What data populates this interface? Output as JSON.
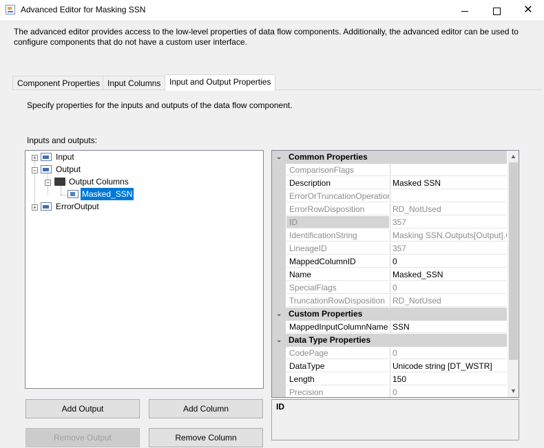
{
  "window": {
    "title": "Advanced Editor for Masking SSN",
    "minimize_label": "",
    "close_label": "✕"
  },
  "description": "The advanced editor provides access to the low-level properties of data flow components. Additionally, the advanced editor can be used to configure components that do not have a custom user interface.",
  "tabs": [
    {
      "label": "Component Properties"
    },
    {
      "label": "Input Columns"
    },
    {
      "label": "Input and Output Properties"
    }
  ],
  "panel": {
    "intro": "Specify properties for the inputs and outputs of the data flow component.",
    "io_label": "Inputs and outputs:"
  },
  "tree": {
    "input": "Input",
    "output": "Output",
    "output_columns": "Output Columns",
    "masked_ssn": "Masked_SSN",
    "error_output": "ErrorOutput",
    "expand_plus": "+",
    "expand_minus": "−"
  },
  "grid": {
    "collapse_glyph": "⌄",
    "categories": {
      "common": "Common Properties",
      "custom": "Custom Properties",
      "datatype": "Data Type Properties"
    },
    "common_rows": [
      {
        "name": "ComparisonFlags",
        "value": ""
      },
      {
        "name": "Description",
        "value": "Masked SSN"
      },
      {
        "name": "ErrorOrTruncationOperation",
        "value": ""
      },
      {
        "name": "ErrorRowDisposition",
        "value": "RD_NotUsed"
      },
      {
        "name": "ID",
        "value": "357"
      },
      {
        "name": "IdentificationString",
        "value": "Masking SSN.Outputs[Output].C"
      },
      {
        "name": "LineageID",
        "value": "357"
      },
      {
        "name": "MappedColumnID",
        "value": "0"
      },
      {
        "name": "Name",
        "value": "Masked_SSN"
      },
      {
        "name": "SpecialFlags",
        "value": "0"
      },
      {
        "name": "TruncationRowDisposition",
        "value": "RD_NotUsed"
      }
    ],
    "custom_rows": [
      {
        "name": "MappedInputColumnName",
        "value": "SSN"
      }
    ],
    "datatype_rows": [
      {
        "name": "CodePage",
        "value": "0"
      },
      {
        "name": "DataType",
        "value": "Unicode string [DT_WSTR]"
      },
      {
        "name": "Length",
        "value": "150"
      },
      {
        "name": "Precision",
        "value": "0"
      }
    ],
    "scroll_up": "▲",
    "scroll_down": "▼"
  },
  "description_box": {
    "title": "ID"
  },
  "buttons": {
    "add_output": "Add Output",
    "add_column": "Add Column",
    "remove_output": "Remove Output",
    "remove_column": "Remove Column"
  },
  "colors": {
    "selection": "#0078d7",
    "category_bg": "#d4d4d4"
  }
}
